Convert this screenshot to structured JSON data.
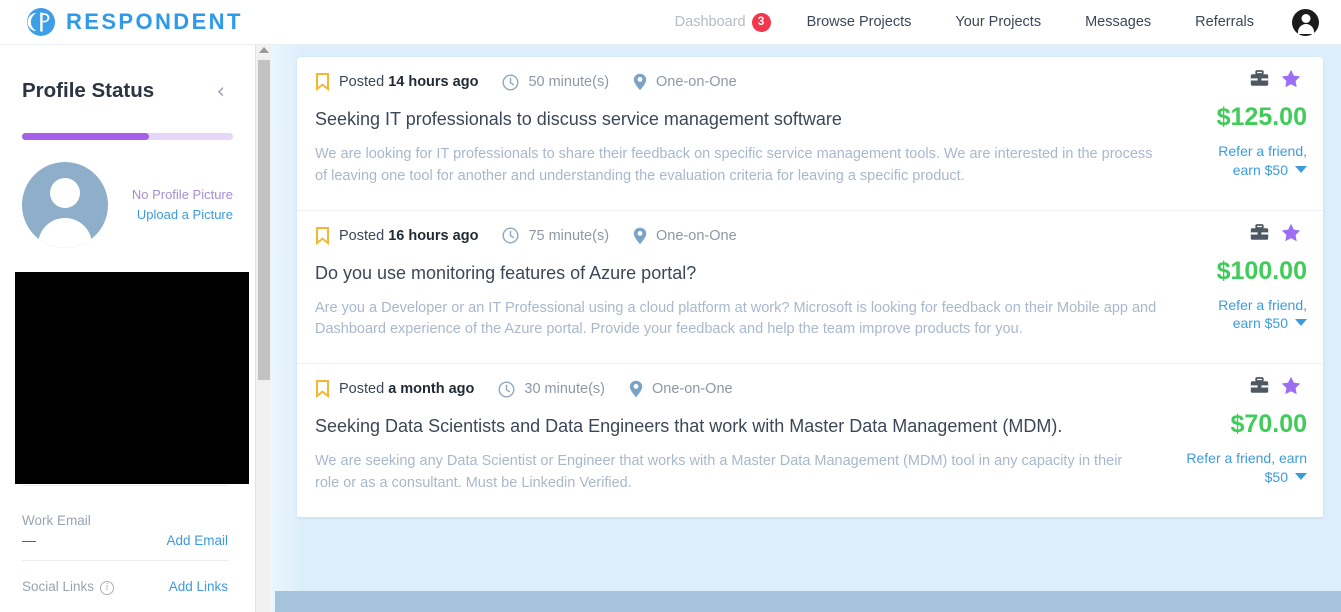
{
  "brand": {
    "name": "RESPONDENT",
    "logo_icon": "respondent-logo-icon",
    "color": "#2f9ae8"
  },
  "nav": {
    "items": [
      {
        "label": "Dashboard",
        "badge": "3",
        "active": false
      },
      {
        "label": "Browse Projects"
      },
      {
        "label": "Your Projects"
      },
      {
        "label": "Messages"
      },
      {
        "label": "Referrals"
      }
    ],
    "avatar_icon": "user-avatar-icon"
  },
  "sidebar": {
    "title": "Profile Status",
    "collapse_icon": "chevron-left-icon",
    "progress_percent": 60,
    "progress_fill_color": "#a560ea",
    "progress_track_color": "#e6d6f7",
    "avatar_icon": "profile-placeholder-icon",
    "no_picture_label": "No Profile Picture",
    "upload_label": "Upload a Picture",
    "fields": [
      {
        "label": "Work Email",
        "value": "—",
        "action": "Add Email"
      },
      {
        "label": "Social Links",
        "value": "",
        "action": "Add Links",
        "info_icon": "info-icon"
      }
    ]
  },
  "scrollbar": {
    "up_arrow_icon": "scroll-up-arrow-icon",
    "thumb_icon": "scrollbar-thumb"
  },
  "cards": [
    {
      "posted_prefix": "Posted",
      "posted_value": "14 hours ago",
      "duration": "50 minute(s)",
      "format": "One-on-One",
      "bookmark_icon": "bookmark-icon",
      "clock_icon": "clock-icon",
      "pin_icon": "location-pin-icon",
      "briefcase_icon": "briefcase-icon",
      "star_icon": "star-icon",
      "title": "Seeking IT professionals to discuss service management software",
      "description": "We are looking for IT professionals to share their feedback on specific service management tools. We are interested in the process of leaving one tool for another and understanding the evaluation criteria for leaving a specific product.",
      "price": "$125.00",
      "refer_line1": "Refer a friend,",
      "refer_line2": "earn $50",
      "refer_width": "w1"
    },
    {
      "posted_prefix": "Posted",
      "posted_value": "16 hours ago",
      "duration": "75 minute(s)",
      "format": "One-on-One",
      "bookmark_icon": "bookmark-icon",
      "clock_icon": "clock-icon",
      "pin_icon": "location-pin-icon",
      "briefcase_icon": "briefcase-icon",
      "star_icon": "star-icon",
      "title": "Do you use monitoring features of Azure portal?",
      "description": "Are you a Developer or an IT Professional using a cloud platform at work? Microsoft is looking for feedback on their Mobile app and Dashboard experience of the Azure portal. Provide your feedback and help the team improve products for you.",
      "price": "$100.00",
      "refer_line1": "Refer a friend,",
      "refer_line2": "earn $50",
      "refer_width": "w1"
    },
    {
      "posted_prefix": "Posted",
      "posted_value": "a month ago",
      "duration": "30 minute(s)",
      "format": "One-on-One",
      "bookmark_icon": "bookmark-icon",
      "clock_icon": "clock-icon",
      "pin_icon": "location-pin-icon",
      "briefcase_icon": "briefcase-icon",
      "star_icon": "star-icon",
      "title": "Seeking Data Scientists and Data Engineers that work with Master Data Management (MDM).",
      "description": "We are seeking any Data Scientist or Engineer that works with a Master Data Management (MDM) tool in any capacity in their role or as a consultant. Must be Linkedin Verified.",
      "price": "$70.00",
      "refer_line1": "Refer a friend, earn",
      "refer_line2": "$50",
      "refer_width": "w2"
    }
  ],
  "colors": {
    "price_green": "#3fcc58",
    "link_blue": "#3d9bdc",
    "badge_red": "#f4364c",
    "star_purple": "#9b6ef3",
    "bookmark_yellow": "#f5b731",
    "page_blue": "#dceefb",
    "bottom_strip": "#a6c4de"
  }
}
